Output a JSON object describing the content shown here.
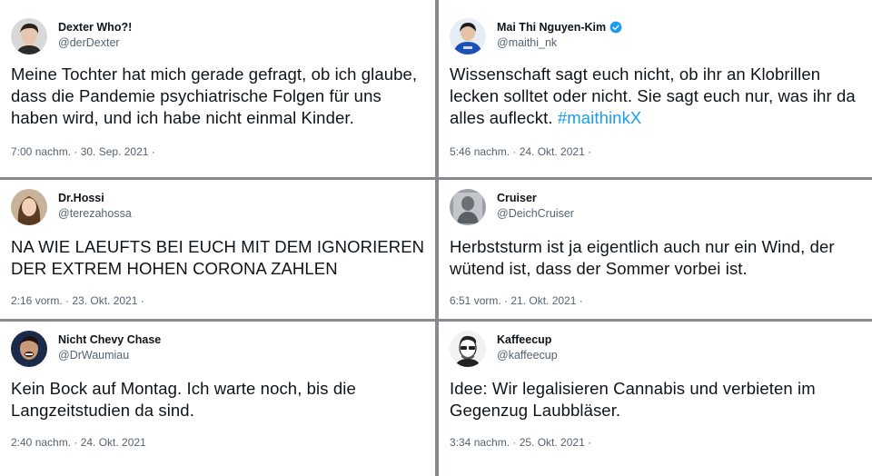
{
  "tweets": [
    {
      "name": "Dexter Who?!",
      "handle": "@derDexter",
      "verified": false,
      "text": "Meine Tochter hat mich gerade gefragt, ob ich glaube, dass die Pandemie psychiatrische Folgen für uns haben wird, und ich habe nicht einmal Kinder.",
      "hashtag": "",
      "timestamp": "7:00 nachm. · 30. Sep. 2021 ·",
      "avatar_icon": "avatar-dark-hair-man"
    },
    {
      "name": "Mai Thi Nguyen-Kim",
      "handle": "@maithi_nk",
      "verified": true,
      "text": "Wissenschaft sagt euch nicht, ob ihr an Klobrillen lecken solltet oder nicht. Sie sagt euch nur, was ihr da alles aufleckt.",
      "hashtag": "#maithinkX",
      "timestamp": "5:46 nachm. · 24. Okt. 2021 ·",
      "avatar_icon": "avatar-blue-shirt-woman"
    },
    {
      "name": "Dr.Hossi",
      "handle": "@terezahossa",
      "verified": false,
      "text": "NA WIE LAEUFTS BEI EUCH MIT DEM IGNORIEREN DER EXTREM HOHEN CORONA ZAHLEN",
      "hashtag": "",
      "timestamp": "2:16 vorm. · 23. Okt. 2021 ·",
      "avatar_icon": "avatar-woman-long-hair"
    },
    {
      "name": "Cruiser",
      "handle": "@DeichCruiser",
      "verified": false,
      "text": "Herbststurm ist ja eigentlich auch nur ein Wind, der wütend ist, dass der Sommer vorbei ist.",
      "hashtag": "",
      "timestamp": "6:51 vorm. · 21. Okt. 2021 ·",
      "avatar_icon": "avatar-grey-figure"
    },
    {
      "name": "Nicht Chevy Chase",
      "handle": "@DrWaumiau",
      "verified": false,
      "text": "Kein Bock auf Montag. Ich warte noch, bis die Langzeitstudien da sind.",
      "hashtag": "",
      "timestamp": "2:40 nachm. · 24. Okt. 2021",
      "avatar_icon": "avatar-laughing-man"
    },
    {
      "name": "Kaffeecup",
      "handle": "@kaffeecup",
      "verified": false,
      "text": "Idee: Wir legalisieren Cannabis und verbieten im Gegenzug Laubbläser.",
      "hashtag": "",
      "timestamp": "3:34 nachm. · 25. Okt. 2021 ·",
      "avatar_icon": "avatar-cartoon-glasses-man"
    }
  ],
  "colors": {
    "text": "#0f1419",
    "secondary": "#536471",
    "link": "#1d9bf0",
    "divider": "#878a8f"
  }
}
